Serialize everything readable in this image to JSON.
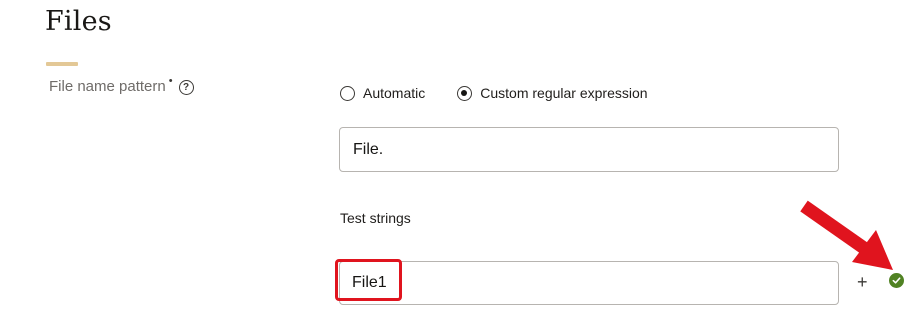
{
  "page": {
    "title": "Files"
  },
  "file_name_pattern": {
    "label": "File name pattern",
    "required_marker": "•",
    "help_icon": "help-circle-icon",
    "options": [
      {
        "label": "Automatic",
        "selected": false
      },
      {
        "label": "Custom regular expression",
        "selected": true
      }
    ],
    "value": "File."
  },
  "test_strings": {
    "label": "Test strings",
    "items": [
      {
        "value": "File1",
        "status": "match",
        "status_icon": "check-circle-icon"
      }
    ],
    "add_label": "+"
  },
  "colors": {
    "accent_underline": "#e3c896",
    "highlight": "#e0141e",
    "success": "#508223"
  }
}
